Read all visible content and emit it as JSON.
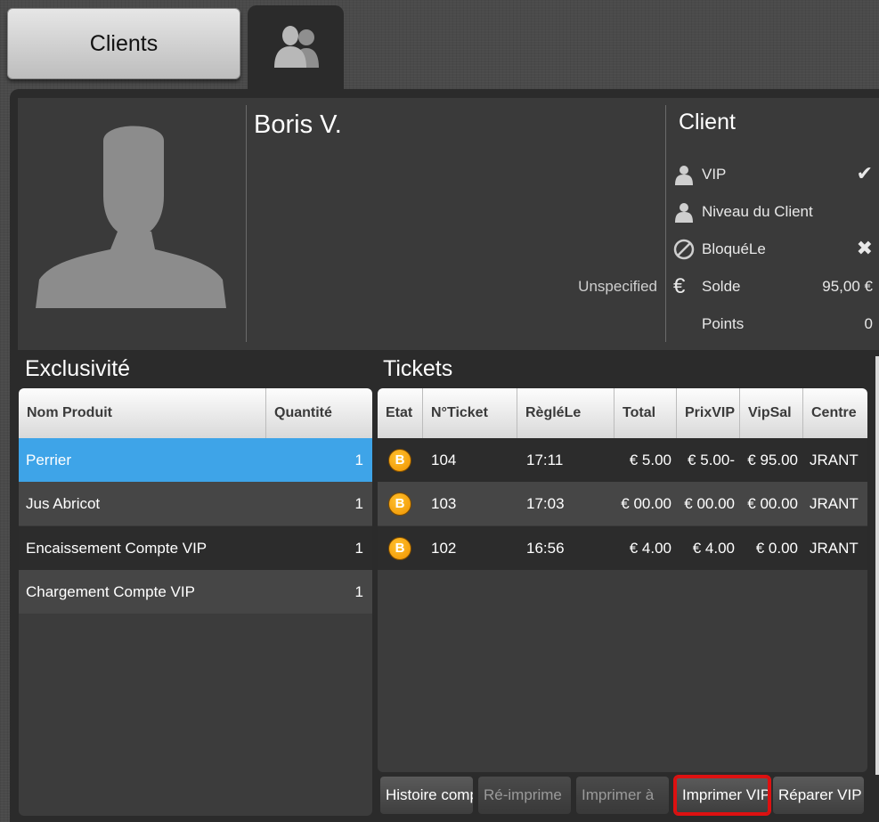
{
  "tabs": {
    "clients_label": "Clients"
  },
  "profile": {
    "name": "Boris V.",
    "gender": "Unspecified"
  },
  "client_panel": {
    "title": "Client",
    "vip_label": "VIP",
    "vip_value": "✔",
    "level_label": "Niveau du Client",
    "level_value": "",
    "blocked_label": "BloquéLe",
    "blocked_value": "✖",
    "balance_label": "Solde",
    "balance_value": "95,00 €",
    "points_label": "Points",
    "points_value": "0"
  },
  "exclusivity": {
    "title": "Exclusivité",
    "columns": [
      "Nom Produit",
      "Quantité"
    ],
    "rows": [
      {
        "product": "Perrier",
        "qty": "1"
      },
      {
        "product": "Jus Abricot",
        "qty": "1"
      },
      {
        "product": "Encaissement Compte VIP",
        "qty": "1"
      },
      {
        "product": "Chargement Compte VIP",
        "qty": "1"
      }
    ]
  },
  "tickets": {
    "title": "Tickets",
    "columns": [
      "Etat",
      "N°Ticket",
      "RègléLe",
      "Total",
      "PrixVIP",
      "VipSal",
      "Centre"
    ],
    "rows": [
      {
        "etat": "B",
        "ticket": "104",
        "date": "17:11",
        "total": "5.00 €",
        "prixvip": "-5.00 €",
        "vipsal": "95.00 €",
        "centre": "JRANT"
      },
      {
        "etat": "B",
        "ticket": "103",
        "date": "17:03",
        "total": "00.00 €",
        "prixvip": "00.00 €",
        "vipsal": "00.00 €",
        "centre": "JRANT"
      },
      {
        "etat": "B",
        "ticket": "102",
        "date": "16:56",
        "total": "4.00 €",
        "prixvip": "4.00 €",
        "vipsal": "0.00 €",
        "centre": "JRANT"
      }
    ]
  },
  "buttons": {
    "history": "Histoire compte",
    "reprint": "Ré-imprime",
    "print_a4": "Imprimer à",
    "print_vip": "Imprimer VIP",
    "repair_vip": "Réparer VIP"
  },
  "colors": {
    "selected_row": "#3ea4e8",
    "badge": "#f2a000",
    "highlight_outline": "#dd1111"
  }
}
